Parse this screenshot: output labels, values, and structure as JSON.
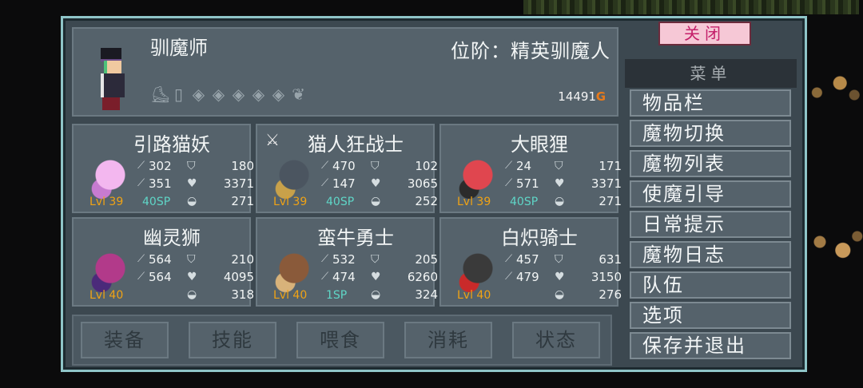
{
  "player": {
    "name": "驯魔师",
    "rank_label": "位阶：",
    "rank_value": "精英驯魔人",
    "gold": "14491",
    "gold_suffix": "G"
  },
  "monsters": [
    {
      "name": "引路猫妖",
      "atk": "302",
      "def": "180",
      "matk": "351",
      "hp": "3371",
      "level": "Lvl 39",
      "sp": "40SP",
      "food": "271",
      "icon": ""
    },
    {
      "name": "猫人狂战士",
      "atk": "470",
      "def": "102",
      "matk": "147",
      "hp": "3065",
      "level": "Lvl 39",
      "sp": "40SP",
      "food": "252",
      "icon": "fork-knife-icon"
    },
    {
      "name": "大眼狸",
      "atk": "24",
      "def": "171",
      "matk": "571",
      "hp": "3371",
      "level": "Lvl 39",
      "sp": "40SP",
      "food": "271",
      "icon": ""
    },
    {
      "name": "幽灵狮",
      "atk": "564",
      "def": "210",
      "matk": "564",
      "hp": "4095",
      "level": "Lvl 40",
      "sp": "",
      "food": "318",
      "icon": ""
    },
    {
      "name": "蛮牛勇士",
      "atk": "532",
      "def": "205",
      "matk": "474",
      "hp": "6260",
      "level": "Lvl 40",
      "sp": "1SP",
      "food": "324",
      "icon": ""
    },
    {
      "name": "白炽骑士",
      "atk": "457",
      "def": "631",
      "matk": "479",
      "hp": "3150",
      "level": "Lvl 40",
      "sp": "",
      "food": "276",
      "icon": ""
    }
  ],
  "tabs": [
    "装备",
    "技能",
    "喂食",
    "消耗",
    "状态"
  ],
  "close_label": "关闭",
  "menu": {
    "title": "菜单",
    "items": [
      "物品栏",
      "魔物切换",
      "魔物列表",
      "使魔引导",
      "日常提示",
      "魔物日志",
      "队伍",
      "选项",
      "保存并退出"
    ]
  },
  "colors": {
    "level": "#f0a315",
    "sp": "#5fd6c7",
    "gold_suffix": "#e87a1a",
    "panel_border": "#8fc5c8",
    "close_bg": "#f6c8d6"
  }
}
